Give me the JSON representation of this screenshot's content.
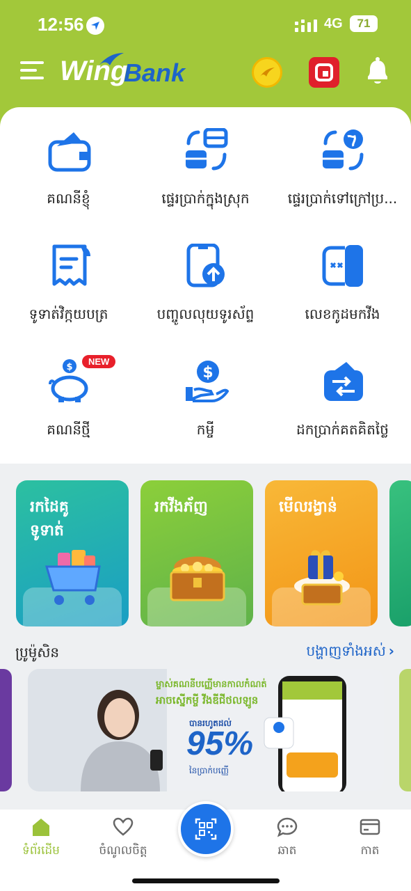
{
  "status_bar": {
    "time": "12:56",
    "network": "4G",
    "battery": "71"
  },
  "header": {
    "logo_wing": "Wing",
    "logo_bank": "Bank"
  },
  "services": [
    {
      "label": "គណនីខ្ញុំ",
      "icon": "wallet-icon"
    },
    {
      "label": "ផ្ទេរប្រាក់ក្នុងស្រុក",
      "icon": "local-transfer-icon"
    },
    {
      "label": "ផ្ទេរប្រាក់ទៅក្រៅប្រ...",
      "icon": "international-transfer-icon"
    },
    {
      "label": "ទូទាត់វិក្កយបត្រ",
      "icon": "bill-icon"
    },
    {
      "label": "បញ្ចូលលុយទូរស័ព្ទ",
      "icon": "phone-topup-icon"
    },
    {
      "label": "លេខកូដមកវីង",
      "icon": "code-icon"
    },
    {
      "label": "គណនីថ្មី",
      "icon": "piggy-bank-icon",
      "badge": "NEW"
    },
    {
      "label": "កម្ចី",
      "icon": "loan-icon"
    },
    {
      "label": "ដកប្រាក់គតគិតថ្លៃ",
      "icon": "cash-withdraw-icon"
    }
  ],
  "promo_cards": [
    {
      "title_1": "រកដៃគូ",
      "title_2": "ទូទាត់",
      "color": "#22aab0"
    },
    {
      "title_1": "រកវីងភ័ញ",
      "title_2": "",
      "color": "#7cc23e"
    },
    {
      "title_1": "មើលរង្វាន់",
      "title_2": "",
      "color": "#f4a21c"
    }
  ],
  "promotion": {
    "heading": "ប្រូម៉ូសិន",
    "see_all": "បង្ហាញទាំងអស់",
    "banner_line1": "ម្ចាស់គណនីបញ្ញើមានកាលកំណត់",
    "banner_line2": "អាចស្នើកម្ចី វីងឌីជីថលឡូន",
    "banner_line3": "បានរហូតដល់",
    "banner_percent": "95%",
    "banner_line4": "នៃប្រាក់បញ្ញើ"
  },
  "bottom_nav": [
    {
      "label": "ទំព័រដើម",
      "icon": "home-icon",
      "active": true
    },
    {
      "label": "ចំណូលចិត្ត",
      "icon": "heart-icon"
    },
    {
      "label": "ឆាត",
      "icon": "chat-icon"
    },
    {
      "label": "កាត",
      "icon": "card-icon"
    }
  ],
  "colors": {
    "brand_green": "#a2c83a",
    "brand_blue": "#1e74e8",
    "new_badge": "#e8202b"
  }
}
